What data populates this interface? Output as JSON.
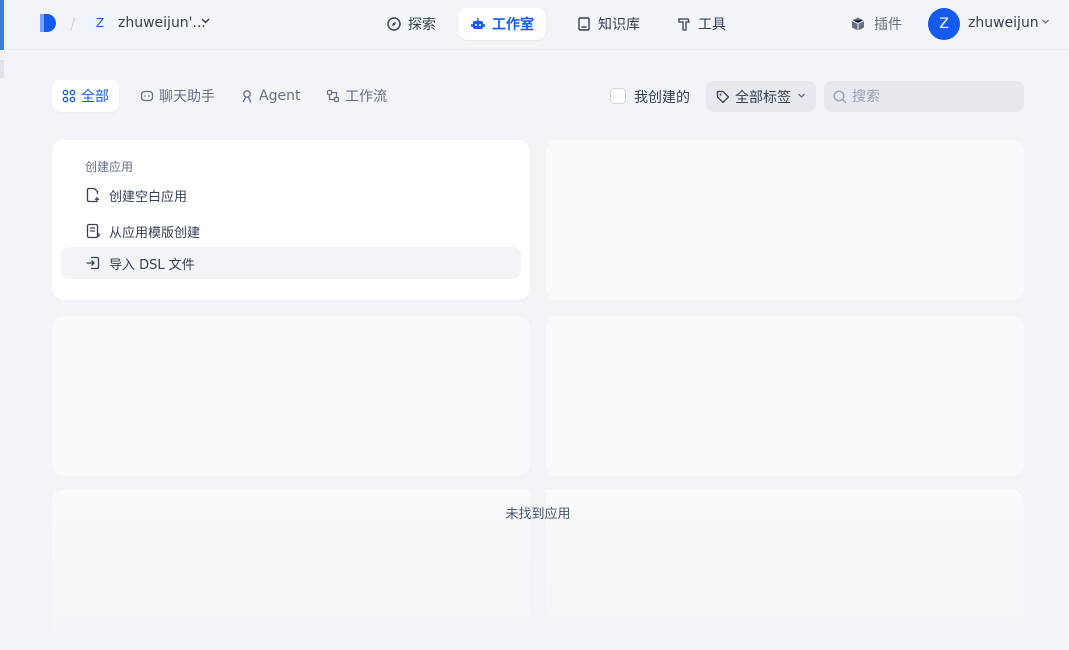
{
  "header": {
    "workspace_initial": "Z",
    "workspace_name": "zhuweijun'...",
    "nav": [
      {
        "label": "探索"
      },
      {
        "label": "工作室"
      },
      {
        "label": "知识库"
      },
      {
        "label": "工具"
      }
    ],
    "active_nav": "工作室",
    "plugin_label": "插件",
    "user_initial": "Z",
    "user_name": "zhuweijun"
  },
  "filters": {
    "tabs": [
      {
        "label": "全部"
      },
      {
        "label": "聊天助手"
      },
      {
        "label": "Agent"
      },
      {
        "label": "工作流"
      }
    ],
    "active_tab": "全部",
    "created_by_me_label": "我创建的",
    "created_by_me_checked": false,
    "tags_label": "全部标签",
    "search_placeholder": "搜索"
  },
  "create_card": {
    "title": "创建应用",
    "items": [
      {
        "label": "创建空白应用",
        "icon": "file-plus-icon"
      },
      {
        "label": "从应用模版创建",
        "icon": "template-icon"
      },
      {
        "label": "导入 DSL 文件",
        "icon": "import-icon"
      }
    ]
  },
  "empty_message": "未找到应用",
  "colors": {
    "accent": "#155aef",
    "background": "#f2f4f7"
  }
}
